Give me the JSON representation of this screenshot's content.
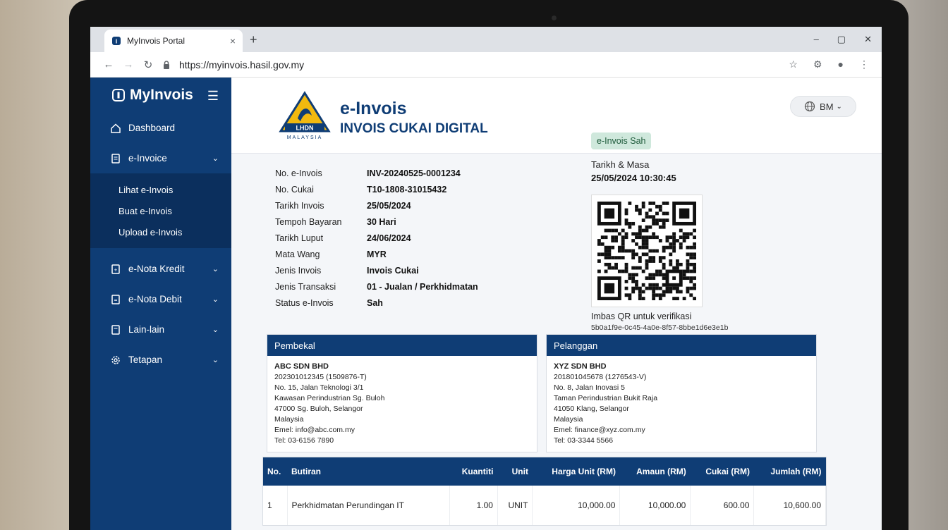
{
  "browser": {
    "tab_title": "MyInvois Portal",
    "url": "https://myinvois.hasil.gov.my",
    "new_tab": "+",
    "tab_close": "×"
  },
  "sidebar": {
    "brand": "MyInvois",
    "items": [
      {
        "label": "Dashboard",
        "icon": "home-icon"
      },
      {
        "label": "e-Invoice",
        "icon": "document-icon"
      },
      {
        "label": "e-Nota Kredit",
        "icon": "credit-note-icon"
      },
      {
        "label": "e-Nota Debit",
        "icon": "debit-note-icon"
      },
      {
        "label": "Lain-lain",
        "icon": "folder-icon"
      },
      {
        "label": "Tetapan",
        "icon": "gear-icon"
      }
    ],
    "subitems": [
      "Lihat e-Invois",
      "Buat e-Invois",
      "Upload e-Invois"
    ]
  },
  "header": {
    "title": "e-Invois",
    "subtitle": "INVOIS CUKAI DIGITAL",
    "logo_text": "LHDN",
    "logo_country": "MALAYSIA",
    "lang": "BM"
  },
  "invoice_meta": [
    {
      "label": "No. e-Invois",
      "value": "INV-20240525-0001234"
    },
    {
      "label": "No. Cukai",
      "value": "T10-1808-31015432"
    },
    {
      "label": "Tarikh Invois",
      "value": "25/05/2024"
    },
    {
      "label": "Tempoh Bayaran",
      "value": "30 Hari"
    },
    {
      "label": "Tarikh Luput",
      "value": "24/06/2024"
    },
    {
      "label": "Mata Wang",
      "value": "MYR"
    },
    {
      "label": "Jenis Invois",
      "value": "Invois Cukai"
    },
    {
      "label": "Jenis Transaksi",
      "value": "01 - Jualan / Perkhidmatan"
    },
    {
      "label": "Status e-Invois",
      "value": "Sah"
    }
  ],
  "verification": {
    "badge": "e-Invois Sah",
    "datetime_label": "Tarikh & Masa",
    "datetime_value": "25/05/2024 10:30:45",
    "qr_caption": "Imbas QR untuk verifikasi",
    "uuid": "5b0a1f9e-0c45-4a0e-8f57-8bbe1d6e3e1b"
  },
  "supplier": {
    "heading": "Pembekal",
    "name": "ABC SDN BHD",
    "reg": "202301012345 (1509876-T)",
    "addr1": "No. 15, Jalan Teknologi 3/1",
    "addr2": "Kawasan Perindustrian Sg. Buloh",
    "addr3": "47000 Sg. Buloh, Selangor",
    "country": "Malaysia",
    "email": "Emel: info@abc.com.my",
    "tel": "Tel: 03-6156 7890"
  },
  "customer": {
    "heading": "Pelanggan",
    "name": "XYZ SDN BHD",
    "reg": "201801045678 (1276543-V)",
    "addr1": "No. 8, Jalan Inovasi 5",
    "addr2": "Taman Perindustrian Bukit Raja",
    "addr3": "41050 Klang, Selangor",
    "country": "Malaysia",
    "email": "Emel: finance@xyz.com.my",
    "tel": "Tel: 03-3344 5566"
  },
  "items_table": {
    "headers": [
      "No.",
      "Butiran",
      "Kuantiti",
      "Unit",
      "Harga Unit (RM)",
      "Amaun (RM)",
      "Cukai (RM)",
      "Jumlah (RM)"
    ],
    "rows": [
      [
        "1",
        "Perkhidmatan Perundingan IT",
        "1.00",
        "UNIT",
        "10,000.00",
        "10,000.00",
        "600.00",
        "10,600.00"
      ]
    ]
  },
  "colors": {
    "brand_navy": "#0f3d75",
    "badge_green": "#cfe8dc"
  }
}
